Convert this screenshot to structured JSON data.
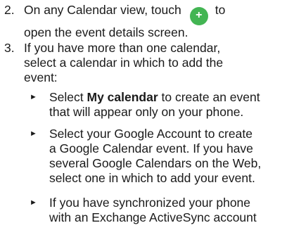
{
  "steps": [
    {
      "number": "2.",
      "text_before": "On any Calendar view, touch",
      "icon": "plus-icon",
      "icon_color": "#43b553",
      "text_after": "to",
      "text_line2": "open the event details screen."
    },
    {
      "number": "3.",
      "line1": "If you have more than one calendar,",
      "line2": "select a calendar in which to add the",
      "line3": "event:"
    }
  ],
  "bullets": [
    {
      "bold": "My calendar",
      "before": "Select ",
      "after": " to create an event",
      "line2": "that will appear only on your phone."
    },
    {
      "line1": "Select your Google Account to create",
      "line2": "a Google Calendar event. If you have",
      "line3": "several Google Calendars on the Web,",
      "line4": "select one in which to add your event."
    },
    {
      "line1": "If you have synchronized your phone",
      "line2": "with an Exchange ActiveSync account"
    }
  ],
  "bullet_glyph": "►"
}
